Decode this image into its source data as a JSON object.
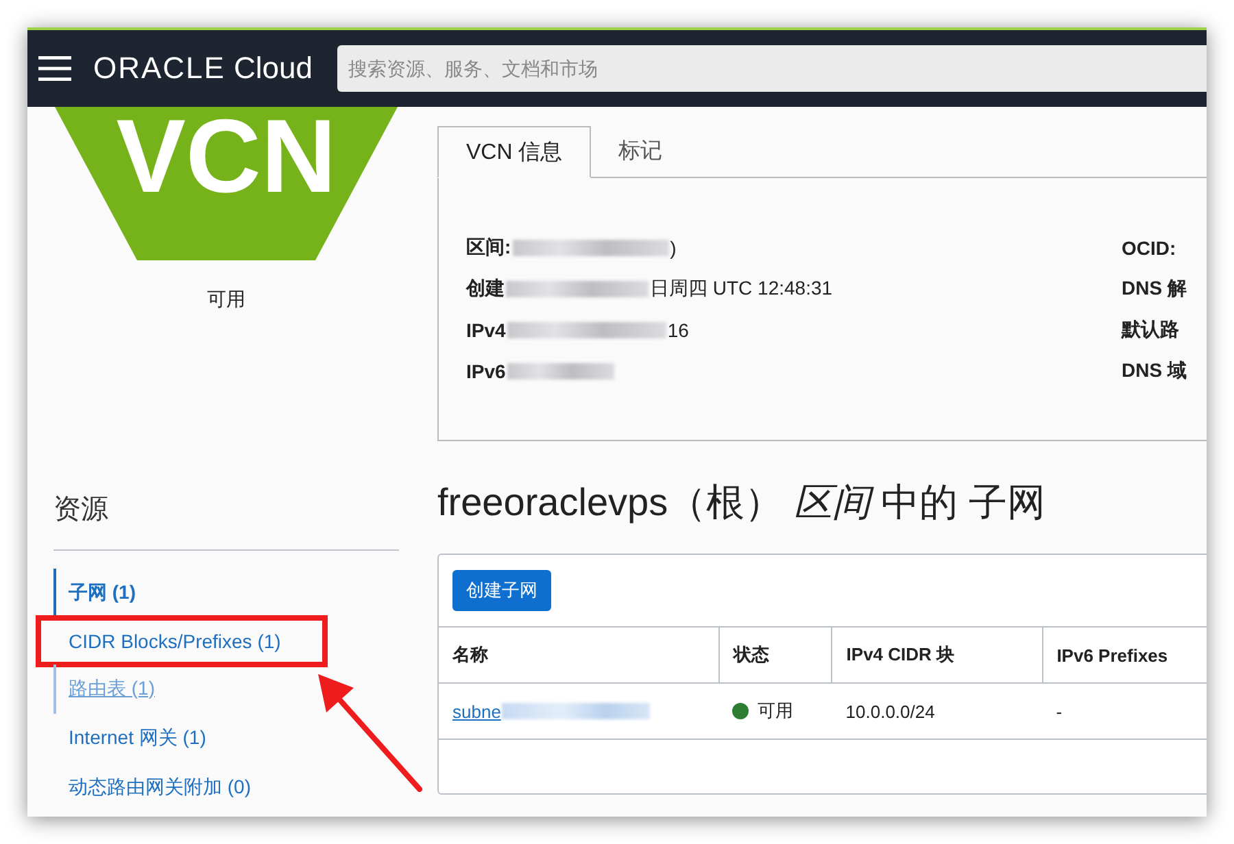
{
  "header": {
    "logo_brand": "ORACLE",
    "logo_product": "Cloud",
    "search": {
      "placeholder": "搜索资源、服务、文档和市场"
    }
  },
  "vcn": {
    "badge": "VCN",
    "status": "可用"
  },
  "tabs": [
    {
      "label": "VCN 信息",
      "selected": true
    },
    {
      "label": "标记",
      "selected": false
    }
  ],
  "info": {
    "left": [
      {
        "label": "区间:",
        "tail": ")",
        "redacted": true
      },
      {
        "label": "创建",
        "tail": "日周四 UTC 12:48:31",
        "redacted": true
      },
      {
        "label": "IPv4",
        "tail": "16",
        "redacted": true
      },
      {
        "label": "IPv6",
        "redacted": true
      }
    ],
    "right": [
      {
        "label": "OCID:"
      },
      {
        "label": "DNS 解"
      },
      {
        "label": "默认路"
      },
      {
        "label": "DNS 域"
      }
    ]
  },
  "resources": {
    "title": "资源",
    "items": [
      {
        "label": "子网 (1)",
        "selected": true,
        "highlighted": false,
        "hovered": false
      },
      {
        "label": "CIDR Blocks/Prefixes (1)",
        "selected": false,
        "highlighted": true,
        "hovered": false
      },
      {
        "label": "路由表 (1)",
        "selected": false,
        "highlighted": false,
        "hovered": true
      },
      {
        "label": "Internet 网关 (1)",
        "selected": false,
        "highlighted": false,
        "hovered": false
      },
      {
        "label": "动态路由网关附加 (0)",
        "selected": false,
        "highlighted": false,
        "hovered": false
      }
    ]
  },
  "subnets": {
    "heading": "freeoraclevps（根） *区间* 中的 子网",
    "create_button": "创建子网",
    "columns": [
      "名称",
      "状态",
      "IPv4 CIDR 块",
      "IPv6 Prefixes"
    ],
    "rows": [
      {
        "name": "subne",
        "redacted": true,
        "status": "可用",
        "color": "#2e7d32",
        "ipv4": "10.0.0.0/24",
        "ipv6": "-"
      }
    ]
  },
  "annotation": {
    "arrow": true
  }
}
